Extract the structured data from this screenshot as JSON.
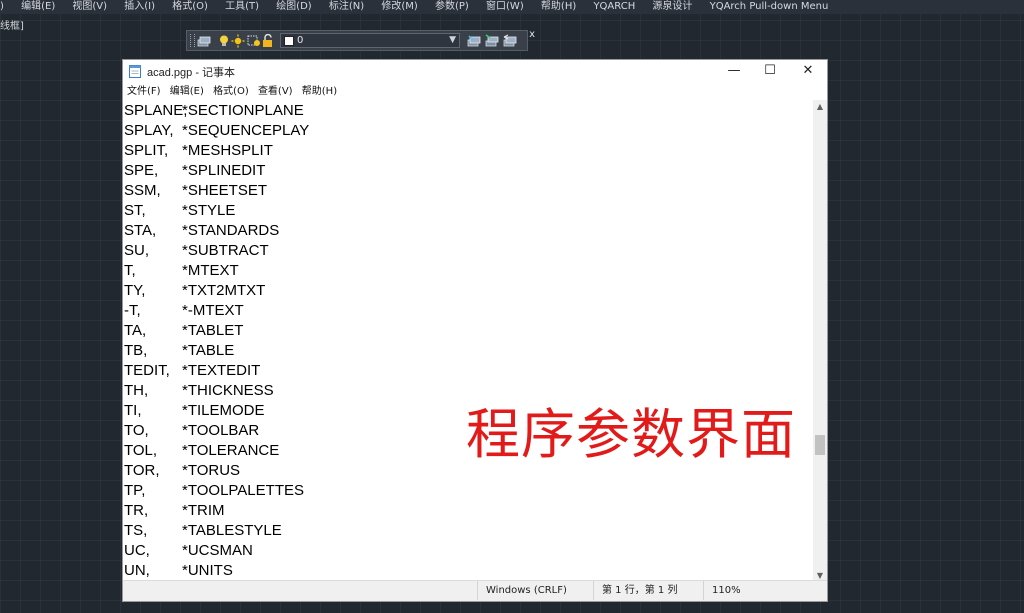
{
  "cad": {
    "menu": [
      ")",
      "编辑(E)",
      "视图(V)",
      "插入(I)",
      "格式(O)",
      "工具(T)",
      "绘图(D)",
      "标注(N)",
      "修改(M)",
      "参数(P)",
      "窗口(W)",
      "帮助(H)",
      "YQARCH",
      "源泉设计",
      "YQArch Pull-down Menu"
    ],
    "sub_label": "线框]",
    "layer_toolbar": {
      "current_layer": "0"
    }
  },
  "notepad": {
    "title": "acad.pgp - 记事本",
    "controls": {
      "minimize": "—",
      "maximize": "☐",
      "close": "✕"
    },
    "menu": [
      "文件(F)",
      "编辑(E)",
      "格式(O)",
      "查看(V)",
      "帮助(H)"
    ],
    "lines": [
      [
        "SPLANE,",
        "*SECTIONPLANE"
      ],
      [
        "SPLAY,",
        "*SEQUENCEPLAY"
      ],
      [
        "SPLIT,",
        "*MESHSPLIT"
      ],
      [
        "SPE,",
        "*SPLINEDIT"
      ],
      [
        "SSM,",
        "*SHEETSET"
      ],
      [
        "ST,",
        "*STYLE"
      ],
      [
        "STA,",
        "*STANDARDS"
      ],
      [
        "SU,",
        "*SUBTRACT"
      ],
      [
        "T,",
        "*MTEXT"
      ],
      [
        "TY,",
        "*TXT2MTXT"
      ],
      [
        "-T,",
        "*-MTEXT"
      ],
      [
        "TA,",
        "*TABLET"
      ],
      [
        "TB,",
        "*TABLE"
      ],
      [
        "TEDIT,",
        "*TEXTEDIT"
      ],
      [
        "TH,",
        "*THICKNESS"
      ],
      [
        "TI,",
        "*TILEMODE"
      ],
      [
        "TO,",
        "*TOOLBAR"
      ],
      [
        "TOL,",
        "*TOLERANCE"
      ],
      [
        "TOR,",
        "*TORUS"
      ],
      [
        "TP,",
        "*TOOLPALETTES"
      ],
      [
        "TR,",
        "*TRIM"
      ],
      [
        "TS,",
        "*TABLESTYLE"
      ],
      [
        "UC,",
        "*UCSMAN"
      ],
      [
        "UN,",
        "*UNITS"
      ]
    ],
    "status": {
      "line_ending": "Windows (CRLF)",
      "position": "第 1 行，第 1 列",
      "zoom": "110%"
    }
  },
  "overlay_caption": "程序参数界面",
  "colors": {
    "cad_bg": "#212830",
    "caption": "#e21a1a"
  }
}
